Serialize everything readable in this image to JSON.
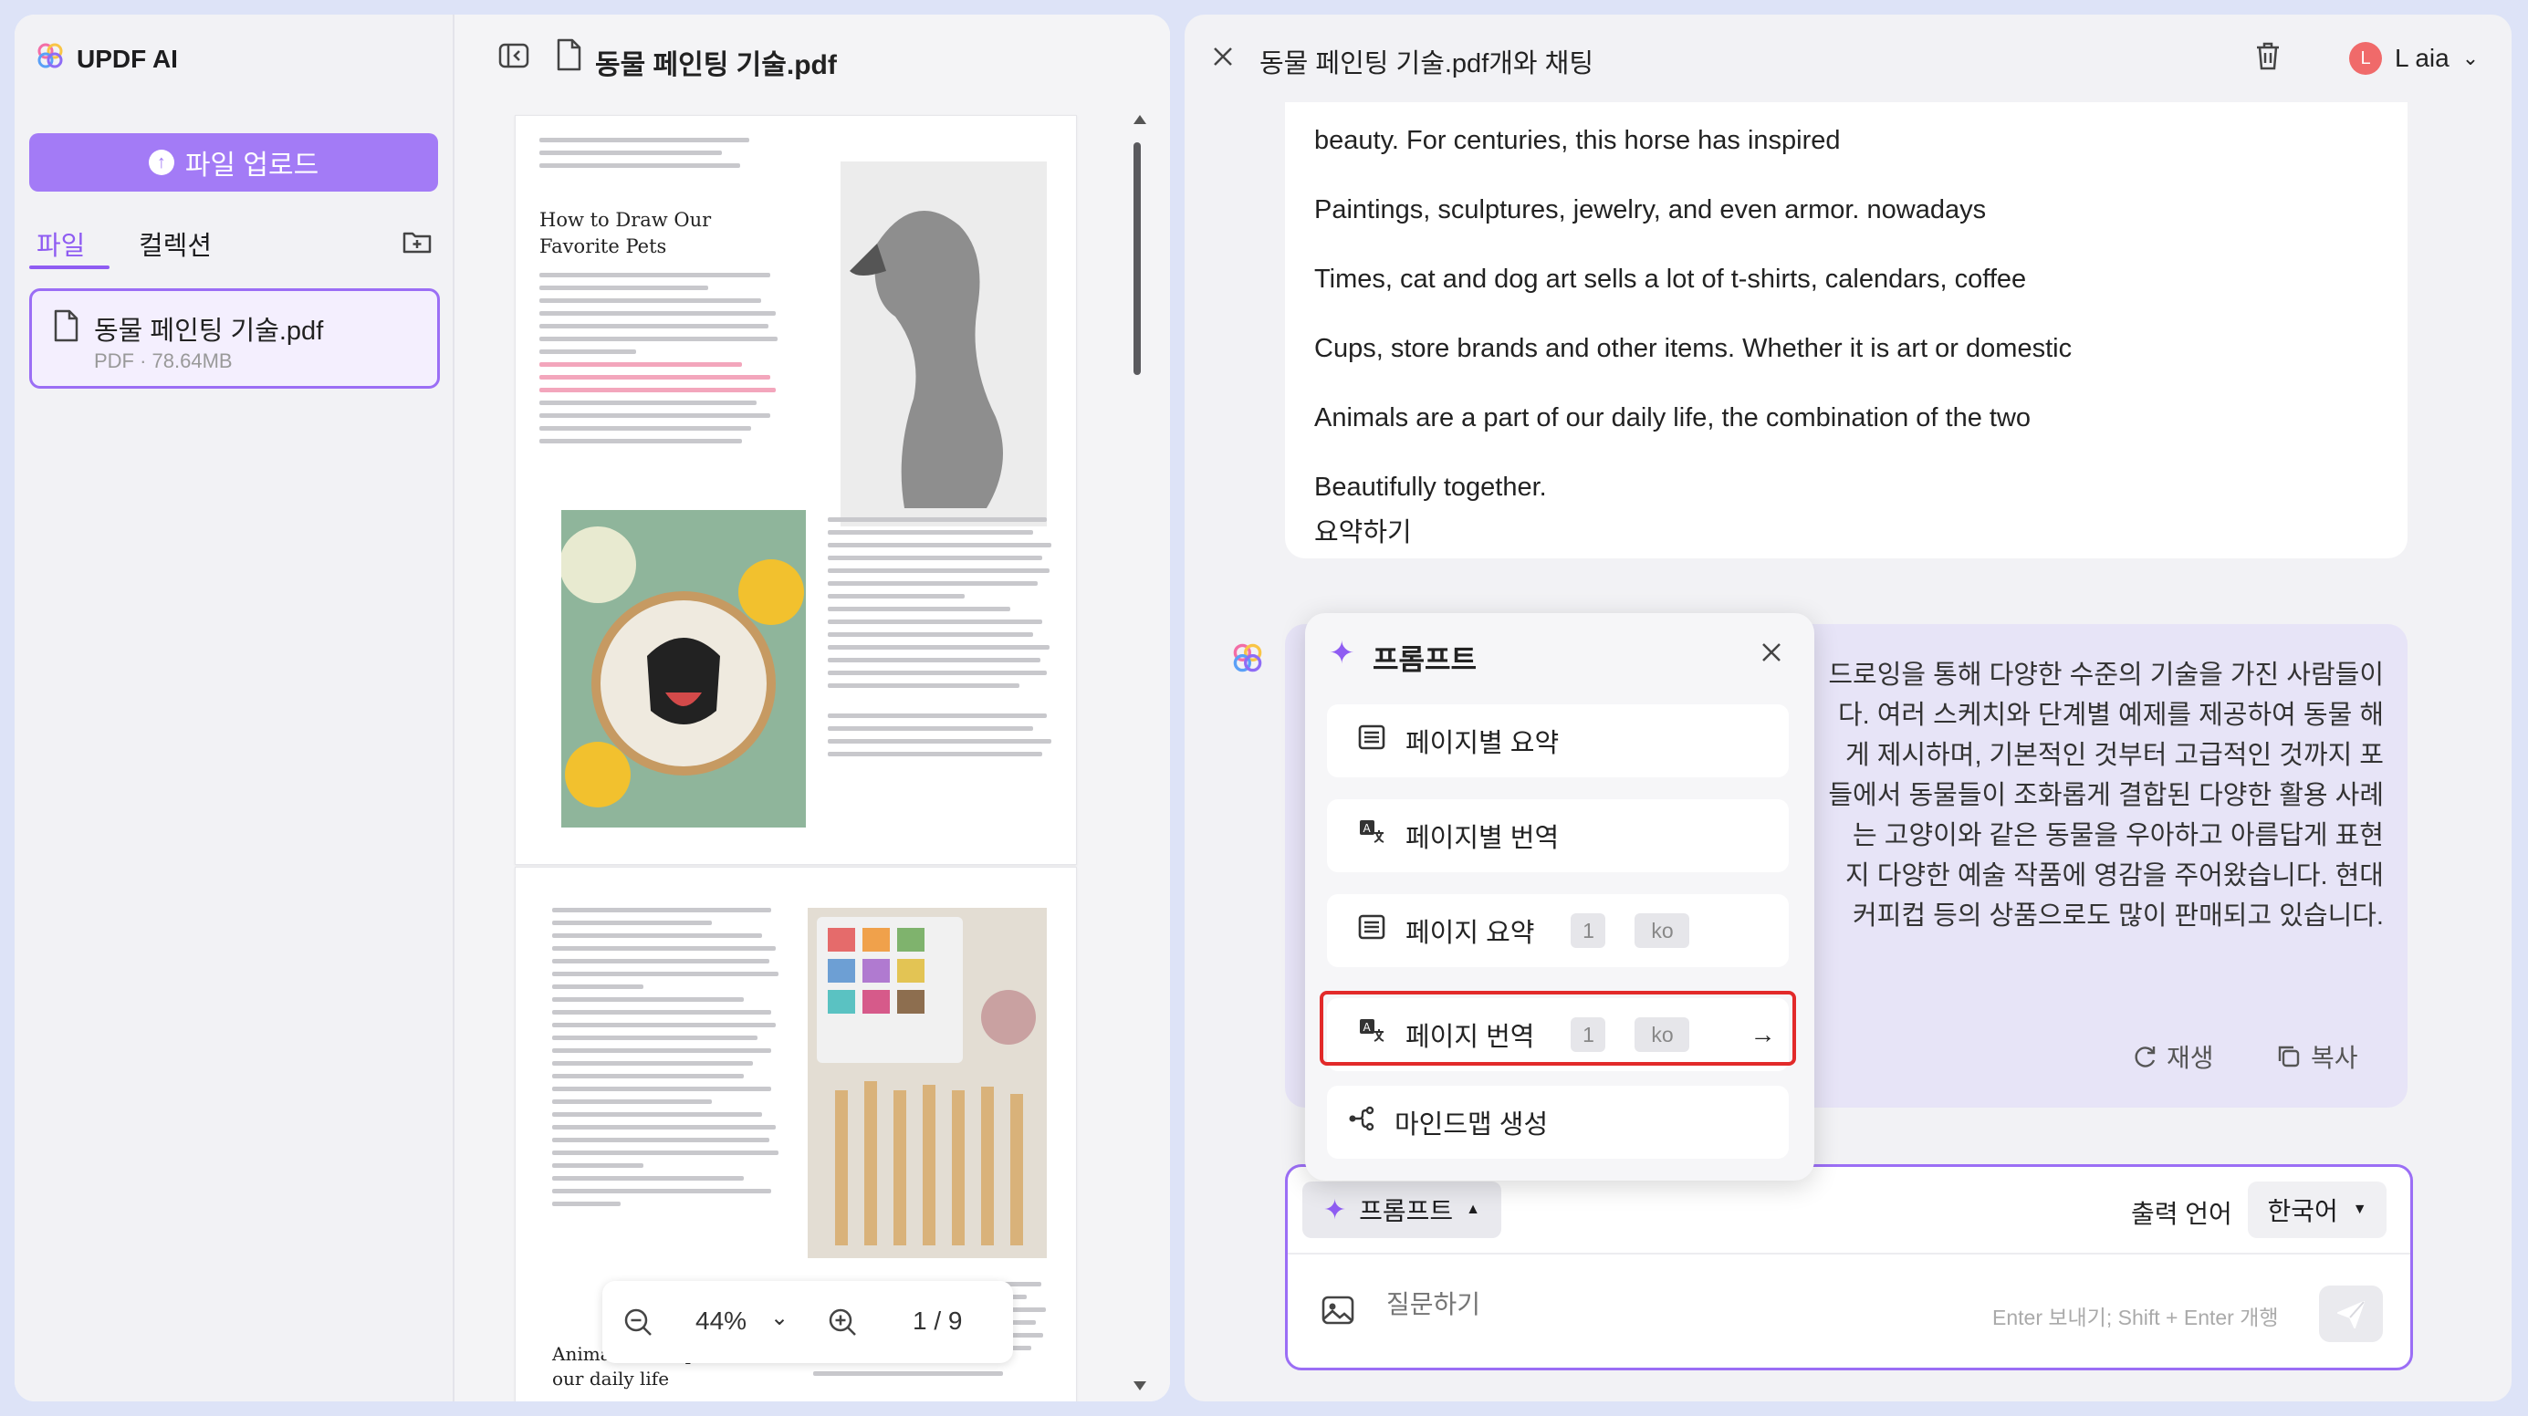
{
  "app": {
    "name": "UPDF AI"
  },
  "sidebar": {
    "upload_label": "파일 업로드",
    "tabs": [
      "파일",
      "컬렉션"
    ],
    "file": {
      "name": "동물 페인팅 기술.pdf",
      "meta": "PDF · 78.64MB"
    }
  },
  "viewer": {
    "title": "동물 페인팅 기술.pdf",
    "page1": {
      "heading_line1": "How to Draw Our",
      "heading_line2": "Favorite Pets"
    },
    "page2": {
      "heading_line1": "Animals are a part of",
      "heading_line2": "our daily life"
    },
    "zoom": "44%",
    "page_indicator": "1 / 9"
  },
  "chat": {
    "title": "동물 페인팅 기술.pdf개와 채팅",
    "user_name": "L aia",
    "avatar_initial": "L",
    "user_message": [
      "beauty. For centuries, this horse has inspired",
      "Paintings, sculptures, jewelry, and even armor. nowadays",
      "Times, cat and dog art sells a lot of t-shirts, calendars, coffee",
      "Cups, store brands and other items. Whether it is art or domestic",
      "Animals are a part of our daily life, the combination of the two",
      "Beautifully together.",
      "요약하기"
    ],
    "ai_response": [
      "드로잉을 통해 다양한 수준의 기술을 가진 사람들이",
      "다. 여러 스케치와 단계별 예제를 제공하여 동물 해",
      "게 제시하며, 기본적인 것부터 고급적인 것까지 포",
      "들에서 동물들이 조화롭게 결합된 다양한 활용 사례",
      "는 고양이와 같은 동물을 우아하고 아름답게 표현",
      "지 다양한 예술 작품에 영감을 주어왔습니다. 현대",
      "커피컵 등의 상품으로도 많이 판매되고 있습니다."
    ],
    "actions": {
      "regenerate": "재생",
      "copy": "복사"
    },
    "composer": {
      "prompt_label": "프롬프트",
      "output_language_label": "출력 언어",
      "language": "한국어",
      "placeholder": "질문하기",
      "hint": "Enter 보내기; Shift + Enter 개행"
    }
  },
  "prompt_popup": {
    "title": "프롬프트",
    "items": [
      {
        "label": "페이지별 요약"
      },
      {
        "label": "페이지별 번역"
      },
      {
        "label": "페이지 요약",
        "page": "1",
        "lang": "ko"
      },
      {
        "label": "페이지 번역",
        "page": "1",
        "lang": "ko"
      },
      {
        "label": "마인드맵 생성"
      }
    ]
  },
  "colors": {
    "accent": "#9b6ef5",
    "upload_button": "#a37bf6",
    "highlight_border": "#e22a2a"
  }
}
